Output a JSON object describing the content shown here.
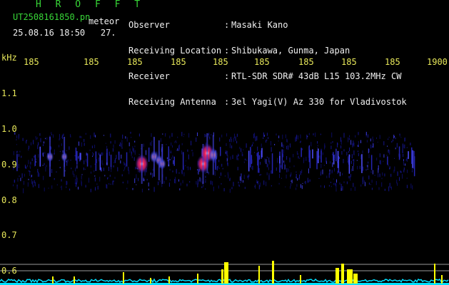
{
  "header": {
    "app_title": "H R O F F T",
    "filename": "UT2508161850.pn",
    "mode": "meteor",
    "datetime": "25.08.16 18:50",
    "counter": "27."
  },
  "station_info": [
    {
      "key": "Observer",
      "value": "Masaki Kano"
    },
    {
      "key": "Receiving Location",
      "value": "Shibukawa, Gunma, Japan"
    },
    {
      "key": "Receiver",
      "value": "RTL-SDR SDR# 43dB L15 103.2MHz CW"
    },
    {
      "key": "Receiving Antenna",
      "value": "3el Yagi(V) Az 330 for Vladivostok"
    }
  ],
  "axes": {
    "y_unit": "kHz",
    "y_ticks": [
      "1.1",
      "1.0",
      "0.9",
      "0.8",
      "0.7",
      "0.6"
    ],
    "x_ticks": [
      "185",
      "185",
      "185",
      "185",
      "185",
      "185",
      "185",
      "185",
      "185",
      "1900"
    ]
  },
  "colors": {
    "text_header": "#37d637",
    "text_info": "#f0f0f0",
    "axis_labels": "#e8e85a",
    "spectrum_trace": "#00e0ff",
    "spectrum_peaks": "#ffff00",
    "echo_hot": "#ff3060",
    "background_noise": "#0a0a6a"
  },
  "echoes": [
    {
      "time_min": 1851.45,
      "freq_khz": 0.9,
      "strength": 0.95
    },
    {
      "time_min": 1851.75,
      "freq_khz": 0.92,
      "strength": 0.5
    },
    {
      "time_min": 1851.87,
      "freq_khz": 0.91,
      "strength": 0.4
    },
    {
      "time_min": 1851.95,
      "freq_khz": 0.9,
      "strength": 0.4
    },
    {
      "time_min": 1852.95,
      "freq_khz": 0.9,
      "strength": 0.9
    },
    {
      "time_min": 1853.05,
      "freq_khz": 0.93,
      "strength": 1.0
    },
    {
      "time_min": 1853.2,
      "freq_khz": 0.925,
      "strength": 0.6
    },
    {
      "time_min": 1849.2,
      "freq_khz": 0.92,
      "strength": 0.35
    },
    {
      "time_min": 1849.55,
      "freq_khz": 0.92,
      "strength": 0.3
    }
  ]
}
